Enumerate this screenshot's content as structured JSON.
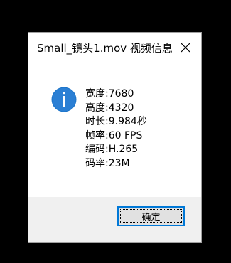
{
  "dialog": {
    "title": "Small_镜头1.mov 视频信息",
    "close_icon": "close-icon",
    "info_icon": "info-icon",
    "accent_color": "#0078d7",
    "lines": [
      {
        "label": "宽度:",
        "value": "7680"
      },
      {
        "label": "高度:",
        "value": "4320"
      },
      {
        "label": "时长:",
        "value": "9.984秒"
      },
      {
        "label": "帧率:",
        "value": "60 FPS"
      },
      {
        "label": "编码:",
        "value": "H.265"
      },
      {
        "label": "码率:",
        "value": "23M"
      }
    ],
    "ok_label": "确定"
  }
}
